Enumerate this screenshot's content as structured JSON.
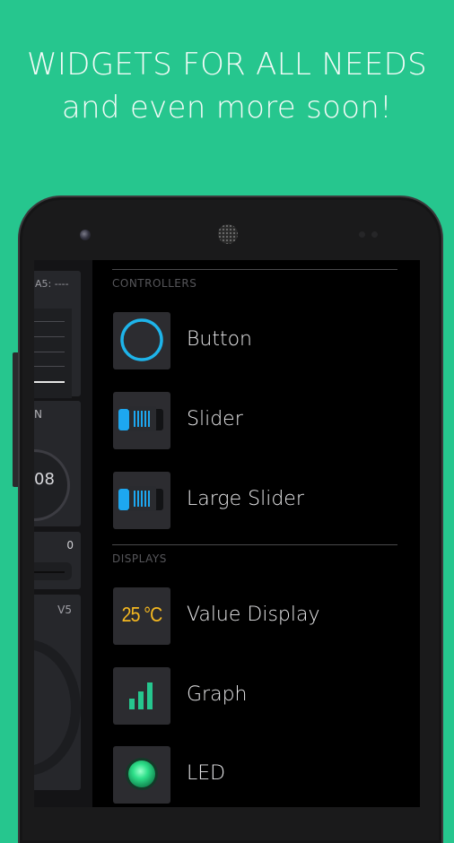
{
  "promo": {
    "headline": "WIDGETS FOR ALL NEEDS",
    "subheadline": "and even more soon!",
    "background_color": "#26c68e"
  },
  "dashboard": {
    "pin_label": "A5: ----",
    "knob_label": "N",
    "knob_value": "08",
    "slider_value": "0",
    "gauge_pin": "V5"
  },
  "widget_box": {
    "sections": [
      {
        "title": "CONTROLLERS",
        "items": [
          {
            "label": "Button",
            "icon": "button-ring-icon"
          },
          {
            "label": "Slider",
            "icon": "slider-icon"
          },
          {
            "label": "Large Slider",
            "icon": "large-slider-icon"
          }
        ]
      },
      {
        "title": "DISPLAYS",
        "items": [
          {
            "label": "Value Display",
            "icon": "value-display-icon",
            "icon_text": "25 °C"
          },
          {
            "label": "Graph",
            "icon": "bar-graph-icon"
          },
          {
            "label": "LED",
            "icon": "led-icon"
          }
        ]
      }
    ],
    "colors": {
      "button_ring": "#1eb4ea",
      "slider": "#1da7f0",
      "value_text": "#f5b820",
      "graph_bars": "#26c68e",
      "led": "#2ee08a"
    }
  }
}
